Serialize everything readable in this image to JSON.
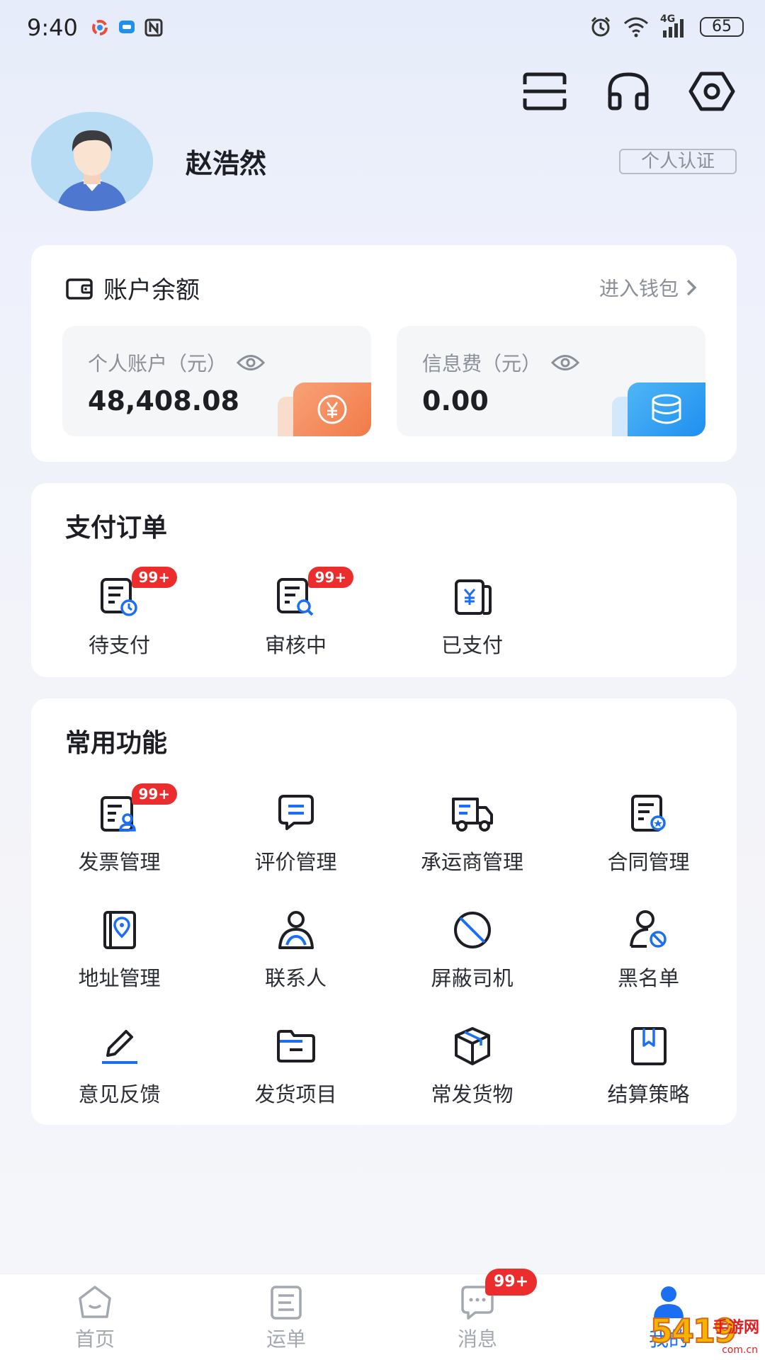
{
  "status_bar": {
    "time": "9:40",
    "network": "4G",
    "battery": "65"
  },
  "header": {
    "icons": [
      "scan-icon",
      "customer-service-icon",
      "settings-icon"
    ]
  },
  "profile": {
    "name": "赵浩然",
    "verify_label": "个人认证"
  },
  "balance": {
    "title": "账户余额",
    "wallet_link": "进入钱包",
    "personal": {
      "label": "个人账户（元）",
      "value": "48,408.08"
    },
    "info_fee": {
      "label": "信息费（元）",
      "value": "0.00"
    },
    "colors": {
      "personal_accent": "#f27a48",
      "info_accent": "#1f8ff0"
    }
  },
  "pay_orders": {
    "title": "支付订单",
    "items": [
      {
        "label": "待支付",
        "badge": "99+",
        "icon": "pending-payment-icon"
      },
      {
        "label": "审核中",
        "badge": "99+",
        "icon": "reviewing-icon"
      },
      {
        "label": "已支付",
        "badge": "",
        "icon": "paid-icon"
      }
    ]
  },
  "functions": {
    "title": "常用功能",
    "items": [
      {
        "label": "发票管理",
        "badge": "99+",
        "icon": "invoice-icon"
      },
      {
        "label": "评价管理",
        "badge": "",
        "icon": "review-message-icon"
      },
      {
        "label": "承运商管理",
        "badge": "",
        "icon": "truck-icon"
      },
      {
        "label": "合同管理",
        "badge": "",
        "icon": "contract-icon"
      },
      {
        "label": "地址管理",
        "badge": "",
        "icon": "address-book-icon"
      },
      {
        "label": "联系人",
        "badge": "",
        "icon": "contact-person-icon"
      },
      {
        "label": "屏蔽司机",
        "badge": "",
        "icon": "block-icon"
      },
      {
        "label": "黑名单",
        "badge": "",
        "icon": "blacklist-user-icon"
      },
      {
        "label": "意见反馈",
        "badge": "",
        "icon": "feedback-pencil-icon"
      },
      {
        "label": "发货项目",
        "badge": "",
        "icon": "folder-icon"
      },
      {
        "label": "常发货物",
        "badge": "",
        "icon": "box-icon"
      },
      {
        "label": "结算策略",
        "badge": "",
        "icon": "bookmark-book-icon"
      }
    ]
  },
  "tabbar": {
    "tabs": [
      {
        "label": "首页",
        "icon": "home-icon"
      },
      {
        "label": "运单",
        "icon": "waybill-icon"
      },
      {
        "label": "消息",
        "icon": "message-icon",
        "badge": "99+"
      },
      {
        "label": "我的",
        "icon": "profile-icon",
        "active": true
      }
    ],
    "active_color": "#1c6ef2"
  },
  "watermark": {
    "number": "5419",
    "text": "手游网",
    "domain": "com.cn"
  }
}
